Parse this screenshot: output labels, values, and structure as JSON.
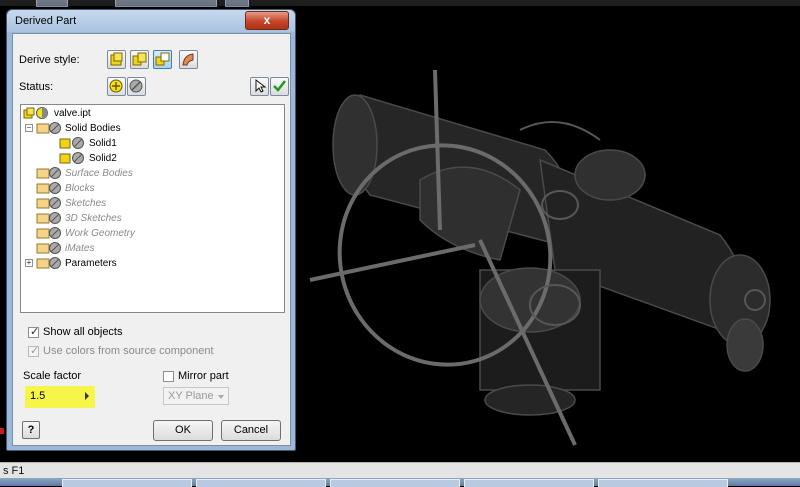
{
  "dialog": {
    "title": "Derived Part",
    "close_glyph": "x",
    "derive_style_label": "Derive style:",
    "status_label": "Status:",
    "tree": {
      "root": "valve.ipt",
      "solid_bodies": "Solid Bodies",
      "solid1": "Solid1",
      "solid2": "Solid2",
      "surface_bodies": "Surface Bodies",
      "blocks": "Blocks",
      "sketches": "Sketches",
      "sketches3d": "3D Sketches",
      "work_geometry": "Work Geometry",
      "imates": "iMates",
      "parameters": "Parameters"
    },
    "show_all_objects": {
      "label": "Show all objects",
      "checked": true
    },
    "use_colors": {
      "label": "Use colors from source component",
      "checked": true,
      "disabled": true
    },
    "scale_factor": {
      "label": "Scale factor",
      "value": "1.5",
      "highlight_color": "#f6f64a"
    },
    "mirror_part": {
      "label": "Mirror part",
      "checked": false
    },
    "mirror_plane": {
      "value": "XY Plane"
    },
    "ok_label": "OK",
    "cancel_label": "Cancel",
    "help_glyph": "?"
  },
  "status_bar": {
    "text": "s F1"
  },
  "icons": [
    "derive-style-single-body-icon",
    "derive-style-keep-seams-icon",
    "derive-style-multiple-bodies-icon",
    "derive-style-surface-icon",
    "status-include-icon",
    "status-exclude-icon",
    "select-from-graphics-icon",
    "apply-check-icon",
    "valve-part-icon",
    "solid-body-icon",
    "folder-icon",
    "expand-icon",
    "collapse-icon"
  ],
  "colors": {
    "accent": "#3c7fb1",
    "viewport_bg": "#000000",
    "highlight": "#f6f64a"
  }
}
